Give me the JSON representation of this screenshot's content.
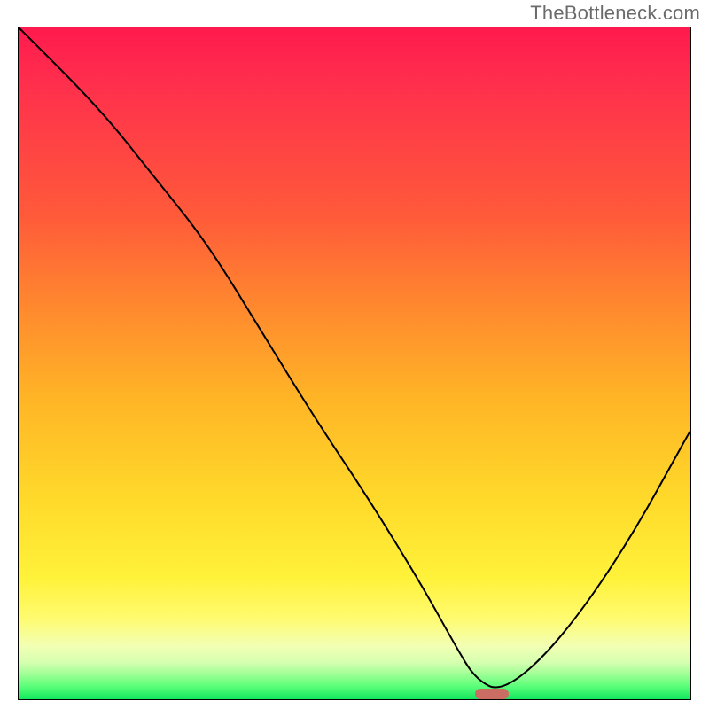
{
  "watermark": "TheBottleneck.com",
  "chart_data": {
    "type": "line",
    "title": "",
    "xlabel": "",
    "ylabel": "",
    "xlim": [
      0,
      100
    ],
    "ylim": [
      0,
      100
    ],
    "grid": false,
    "legend": false,
    "series": [
      {
        "name": "bottleneck-curve",
        "x": [
          0,
          12,
          20,
          28,
          36,
          44,
          52,
          60,
          65,
          68,
          72,
          80,
          90,
          100
        ],
        "values": [
          100,
          88,
          78,
          68,
          55,
          42,
          30,
          17,
          8,
          3,
          1,
          8,
          22,
          40
        ]
      }
    ],
    "minimum_marker": {
      "x_range": [
        68,
        73
      ],
      "y": 0.8
    },
    "gradient_stops": [
      {
        "pos": 0,
        "color": "#ff1a4d"
      },
      {
        "pos": 8,
        "color": "#ff2e4d"
      },
      {
        "pos": 28,
        "color": "#ff5a3a"
      },
      {
        "pos": 42,
        "color": "#ff8a2e"
      },
      {
        "pos": 55,
        "color": "#ffb426"
      },
      {
        "pos": 70,
        "color": "#ffd92a"
      },
      {
        "pos": 82,
        "color": "#fff23a"
      },
      {
        "pos": 88,
        "color": "#fffb70"
      },
      {
        "pos": 92,
        "color": "#f2ffb3"
      },
      {
        "pos": 94.5,
        "color": "#d6ffb0"
      },
      {
        "pos": 96,
        "color": "#a8ff9a"
      },
      {
        "pos": 98,
        "color": "#5eff7a"
      },
      {
        "pos": 100,
        "color": "#11e85e"
      }
    ]
  }
}
